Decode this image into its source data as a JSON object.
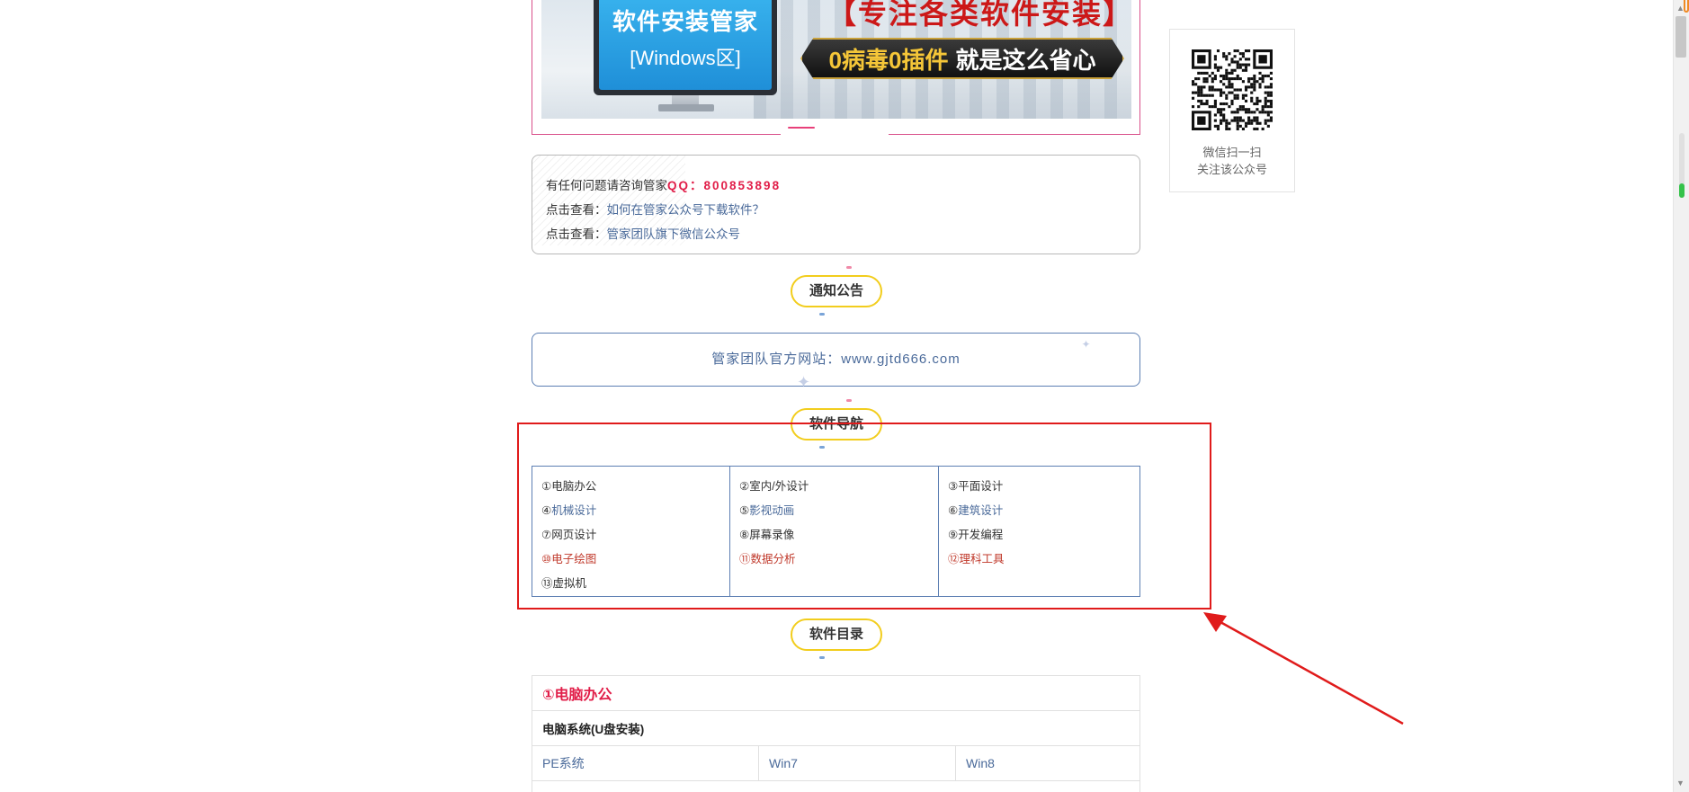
{
  "banner": {
    "monitor_line1": "软件安装管家",
    "monitor_line2": "[Windows区]",
    "headline": "【专注各类软件安装】",
    "slogan_gold": "0病毒0插件",
    "slogan_white": "就是这么省心"
  },
  "qr_card": {
    "caption_line1": "微信扫一扫",
    "caption_line2": "关注该公众号"
  },
  "info": {
    "line1_prefix": "有任何问题请咨询管家",
    "line1_qq": "QQ：800853898",
    "line2_prefix": "点击查看：",
    "line2_link": "如何在管家公众号下载软件？",
    "line3_prefix": "点击查看：",
    "line3_link": "管家团队旗下微信公众号"
  },
  "sections": {
    "notice": "通知公告",
    "nav": "软件导航",
    "catalog": "软件目录"
  },
  "site": {
    "text": "管家团队官方网站：www.gjtd666.com"
  },
  "nav_grid": {
    "columns": [
      [
        {
          "num": "①",
          "label": "电脑办公"
        },
        {
          "num": "④",
          "label": "机械设计"
        },
        {
          "num": "⑦",
          "label": "网页设计"
        },
        {
          "num": "⑩",
          "label": "电子绘图"
        },
        {
          "num": "⑬",
          "label": "虚拟机"
        }
      ],
      [
        {
          "num": "②",
          "label": "室内/外设计"
        },
        {
          "num": "⑤",
          "label": "影视动画"
        },
        {
          "num": "⑧",
          "label": "屏幕录像"
        },
        {
          "num": "⑪",
          "label": "数据分析"
        }
      ],
      [
        {
          "num": "③",
          "label": "平面设计"
        },
        {
          "num": "⑥",
          "label": "建筑设计"
        },
        {
          "num": "⑨",
          "label": "开发编程"
        },
        {
          "num": "⑫",
          "label": "理科工具"
        }
      ]
    ]
  },
  "directory": {
    "title": "①电脑办公",
    "subtitle": "电脑系统(U盘安装)",
    "cells": [
      "PE系统",
      "Win7",
      "Win8"
    ]
  },
  "colors": {
    "qq_red": "#e11d48",
    "link_blue": "#4a6a9a",
    "pill_yellow": "#f2cd1d",
    "annotation_red": "#e01b1b"
  }
}
